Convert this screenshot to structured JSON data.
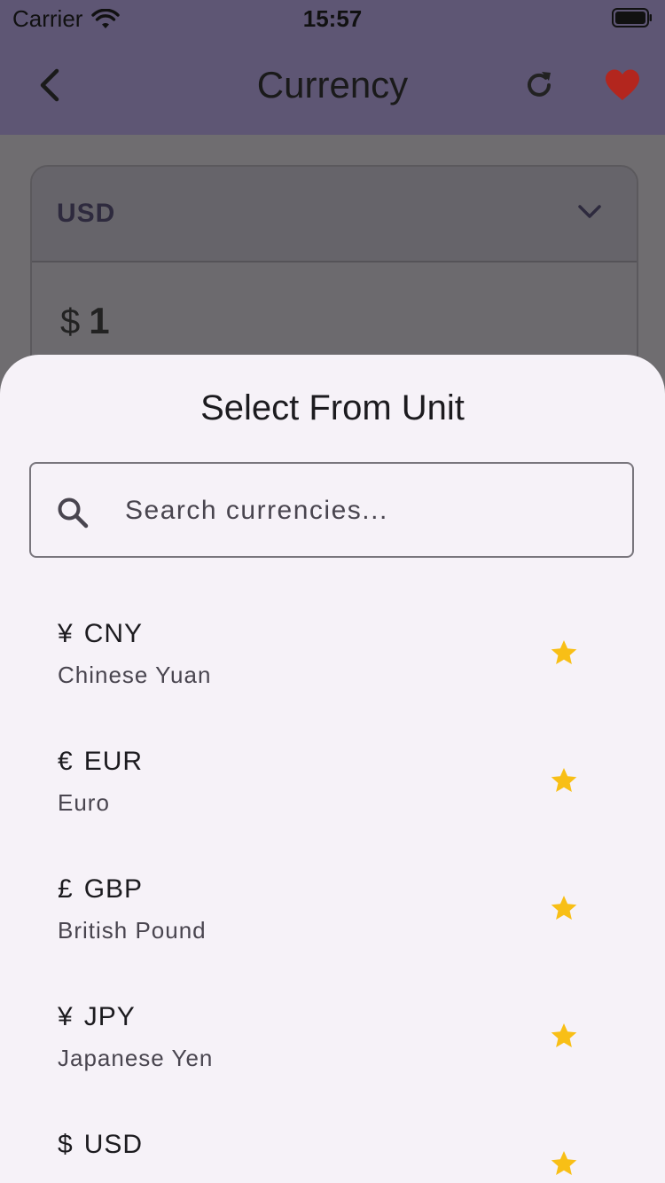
{
  "status_bar": {
    "carrier": "Carrier",
    "time": "15:57"
  },
  "app_bar": {
    "title": "Currency",
    "icons": {
      "back": "back-chevron-icon",
      "refresh": "refresh-icon",
      "favorite": "heart-icon"
    },
    "colors": {
      "background": "#5e5674",
      "heart": "#b3261e"
    }
  },
  "converter": {
    "selected_currency": "USD",
    "amount_symbol": "$",
    "amount_value": "1"
  },
  "sheet": {
    "title": "Select From Unit",
    "search": {
      "placeholder": "Search currencies...",
      "value": ""
    },
    "items": [
      {
        "symbol": "¥",
        "code": "CNY",
        "name": "Chinese Yuan",
        "favorite": true
      },
      {
        "symbol": "€",
        "code": "EUR",
        "name": "Euro",
        "favorite": true
      },
      {
        "symbol": "£",
        "code": "GBP",
        "name": "British Pound",
        "favorite": true
      },
      {
        "symbol": "¥",
        "code": "JPY",
        "name": "Japanese Yen",
        "favorite": true
      },
      {
        "symbol": "$",
        "code": "USD",
        "name": "",
        "favorite": true
      }
    ],
    "colors": {
      "star": "#f8bf16",
      "background": "#f6f2f8"
    }
  }
}
